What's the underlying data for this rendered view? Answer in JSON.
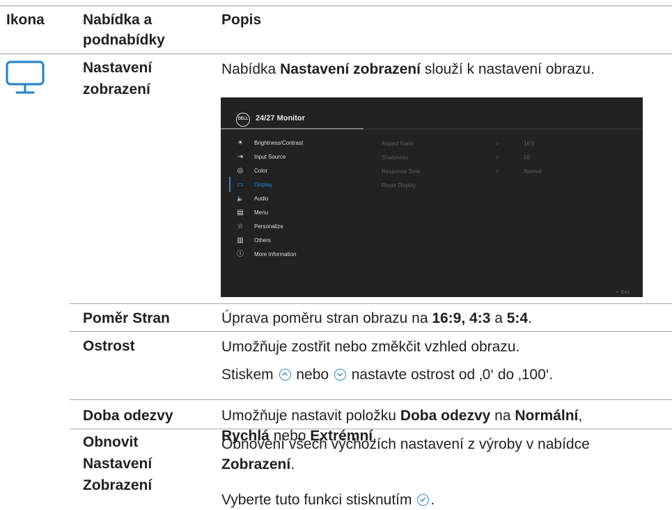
{
  "header": {
    "col_icon": "Ikona",
    "col_menu_line1": "Nabídka a",
    "col_menu_line2": "podnabídky",
    "col_desc": "Popis"
  },
  "display_row": {
    "icon": "monitor-icon",
    "name_line1": "Nastavení",
    "name_line2": "zobrazení",
    "desc_prefix": "Nabídka ",
    "desc_bold": "Nastavení zobrazení",
    "desc_suffix": " slouží k nastavení obrazu."
  },
  "osd": {
    "brand_logo": "DELL",
    "model": "24/27 Monitor",
    "menu_items": [
      {
        "icon": "brightness-icon",
        "glyph": "☀",
        "label": "Brightness/Contrast"
      },
      {
        "icon": "input-source-icon",
        "glyph": "⇥",
        "label": "Input Source"
      },
      {
        "icon": "color-icon",
        "glyph": "◎",
        "label": "Color"
      },
      {
        "icon": "display-icon",
        "glyph": "▭",
        "label": "Display",
        "active": true
      },
      {
        "icon": "audio-icon",
        "glyph": "🔈",
        "label": "Audio"
      },
      {
        "icon": "menu-icon",
        "glyph": "▤",
        "label": "Menu"
      },
      {
        "icon": "star-icon",
        "glyph": "☆",
        "label": "Personalize"
      },
      {
        "icon": "others-icon",
        "glyph": "▥",
        "label": "Others"
      },
      {
        "icon": "info-icon",
        "glyph": "ⓘ",
        "label": "More Information"
      }
    ],
    "submenu": [
      {
        "label": "Aspect Ratio",
        "arrow": ">",
        "value": "16:9"
      },
      {
        "label": "Sharpness",
        "arrow": ">",
        "value": "50"
      },
      {
        "label": "Response Time",
        "arrow": ">",
        "value": "Normal"
      },
      {
        "label": "Reset Display",
        "arrow": "",
        "value": ""
      }
    ],
    "exit_label": "Exit",
    "exit_arrow": "<",
    "accent_color": "#1e86d6"
  },
  "rows": {
    "aspect": {
      "name": "Poměr Stran",
      "desc_prefix": "Úprava poměru stran obrazu na ",
      "bold1": "16:9, 4:3",
      "mid": " a ",
      "bold2": "5:4",
      "end": "."
    },
    "sharpness": {
      "name": "Ostrost",
      "desc1": "Umožňuje zostřit nebo změkčit vzhled obrazu.",
      "desc2_prefix": "Stiskem ",
      "desc2_mid": " nebo ",
      "desc2_suffix": " nastavte ostrost od ‚0‘ do ‚100‘."
    },
    "response": {
      "name": "Doba odezvy",
      "desc_prefix": "Umožňuje nastavit položku ",
      "bold1": "Doba odezvy",
      "mid1": " na ",
      "bold2": "Normální",
      "mid2": ",",
      "bold3": "Rychlá",
      "mid3": " nebo ",
      "bold4": "Extrémní",
      "end": "."
    },
    "reset": {
      "name_line1": "Obnovit",
      "name_line2": "Nastavení",
      "name_line3": "Zobrazení",
      "desc1": "Obnovení všech výchozích nastavení z výroby v nabídce",
      "desc2_bold": "Zobrazení",
      "desc2_end": ".",
      "desc3_prefix": "Vyberte tuto funkci stisknutím ",
      "desc3_end": "."
    }
  }
}
